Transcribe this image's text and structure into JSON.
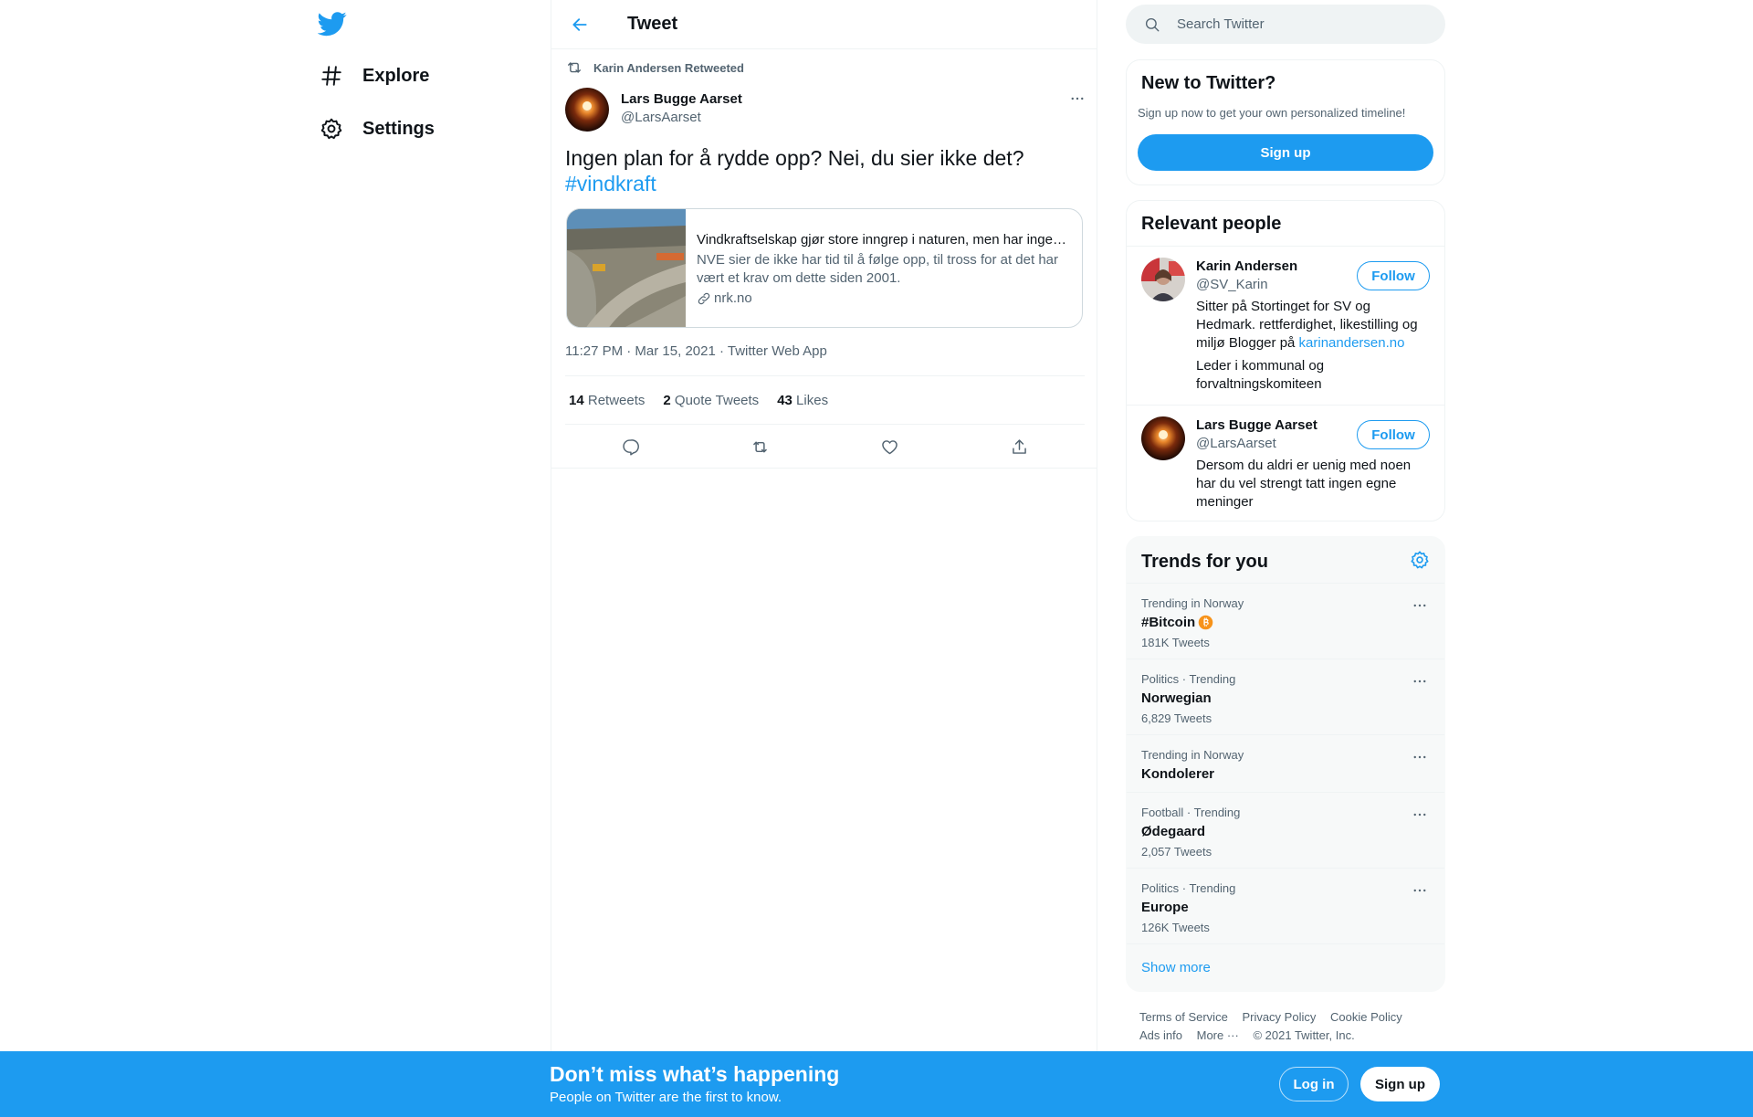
{
  "nav": {
    "logo_icon": "twitter-bird-icon",
    "items": [
      {
        "label": "Explore",
        "icon": "hashtag-icon"
      },
      {
        "label": "Settings",
        "icon": "gear-icon"
      }
    ]
  },
  "header": {
    "title": "Tweet",
    "back_icon": "arrow-left-icon"
  },
  "tweet": {
    "retweeted_by": "Karin Andersen Retweeted",
    "author_name": "Lars Bugge Aarset",
    "author_handle": "@LarsAarset",
    "text": "Ingen plan for å rydde opp? Nei, du sier ikke det? ",
    "hashtag": "#vindkraft",
    "card": {
      "title": "Vindkraftselskap gjør store inngrep i naturen, men har ingen plan for å rydde opp",
      "description": "NVE sier de ikke har tid til å følge opp, til tross for at det har vært et krav om dette siden 2001.",
      "domain": "nrk.no"
    },
    "timestamp": "11:27 PM · Mar 15, 2021 · Twitter Web App",
    "stats": [
      {
        "count": "14",
        "label": "Retweets"
      },
      {
        "count": "2",
        "label": "Quote Tweets"
      },
      {
        "count": "43",
        "label": "Likes"
      }
    ]
  },
  "search": {
    "placeholder": "Search Twitter"
  },
  "new_to_twitter": {
    "title": "New to Twitter?",
    "subtitle": "Sign up now to get your own personalized timeline!",
    "button": "Sign up"
  },
  "relevant_people": {
    "title": "Relevant people",
    "people": [
      {
        "name": "Karin Andersen",
        "handle": "@SV_Karin",
        "bio": "Sitter på Stortinget for SV og Hedmark. rettferdighet, likestilling og miljø Blogger på ",
        "bio_link": "karinandersen.no",
        "bio2": "Leder i kommunal og forvaltningskomiteen",
        "follow": "Follow"
      },
      {
        "name": "Lars Bugge Aarset",
        "handle": "@LarsAarset",
        "bio": "Dersom du aldri er uenig med noen har du vel strengt tatt ingen egne meninger",
        "follow": "Follow"
      }
    ]
  },
  "trends": {
    "title": "Trends for you",
    "items": [
      {
        "meta": "Trending in Norway",
        "name": "#Bitcoin",
        "count": "181K Tweets"
      },
      {
        "meta": "Politics · Trending",
        "name": "Norwegian",
        "count": "6,829 Tweets"
      },
      {
        "meta": "Trending in Norway",
        "name": "Kondolerer",
        "count": ""
      },
      {
        "meta": "Football · Trending",
        "name": "Ødegaard",
        "count": "2,057 Tweets"
      },
      {
        "meta": "Politics · Trending",
        "name": "Europe",
        "count": "126K Tweets"
      }
    ],
    "show_more": "Show more"
  },
  "footer": {
    "terms": "Terms of Service",
    "privacy": "Privacy Policy",
    "cookie": "Cookie Policy",
    "ads": "Ads info",
    "more": "More ···",
    "copyright": "© 2021 Twitter, Inc."
  },
  "bottom_bar": {
    "title": "Don’t miss what’s happening",
    "subtitle": "People on Twitter are the first to know.",
    "login": "Log in",
    "signup": "Sign up"
  },
  "colors": {
    "accent": "#1d9bf0",
    "secondary_text": "#536471",
    "border": "#eff3f4"
  }
}
